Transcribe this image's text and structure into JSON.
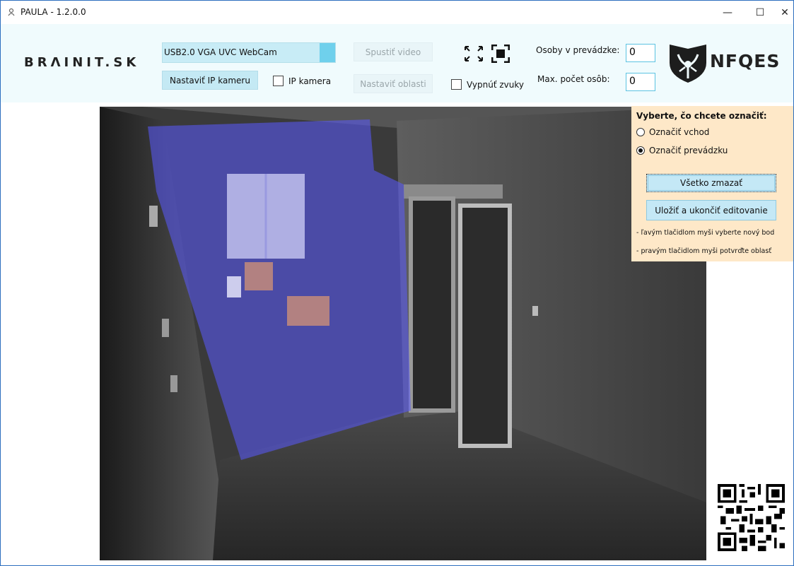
{
  "window": {
    "title": "PAULA - 1.2.0.0",
    "controls": {
      "minimize": "—",
      "maximize": "☐",
      "close": "✕"
    }
  },
  "header": {
    "logo_text": "BRΛINIT.SK",
    "camera_select": {
      "value": "USB2.0 VGA UVC WebCam"
    },
    "set_ip_camera_label": "Nastaviť IP kameru",
    "ip_camera_checkbox": {
      "label": "IP kamera",
      "checked": false
    },
    "start_video_label": "Spustiť video",
    "set_areas_label": "Nastaviť oblasti",
    "mute_sounds_checkbox": {
      "label": "Vypnúť zvuky",
      "checked": false
    },
    "persons_in_shop_label": "Osoby v prevádzke:",
    "persons_in_shop_value": "0",
    "max_persons_label": "Max. počet osôb:",
    "max_persons_value": "0",
    "brand_name": "NFQES",
    "icons": [
      "expand-icon",
      "fullscreen-icon",
      "nfqes-logo-icon"
    ]
  },
  "panel": {
    "title": "Vyberte, čo chcete označiť:",
    "options": [
      {
        "label": "Označiť vchod",
        "selected": false
      },
      {
        "label": "Označiť prevádzku",
        "selected": true
      }
    ],
    "clear_all_label": "Všetko zmazať",
    "save_label": "Uložiť a ukončiť editovanie",
    "hints": [
      "- ľavým tlačidlom myši vyberte nový bod",
      "- pravým tlačidlom myši potvrďte oblasť"
    ]
  },
  "colors": {
    "toolbar_bg": "#f0fbfd",
    "accent": "#6fd0ec",
    "panel_bg": "#fee8c8",
    "area_overlay": "#5a5aff"
  }
}
